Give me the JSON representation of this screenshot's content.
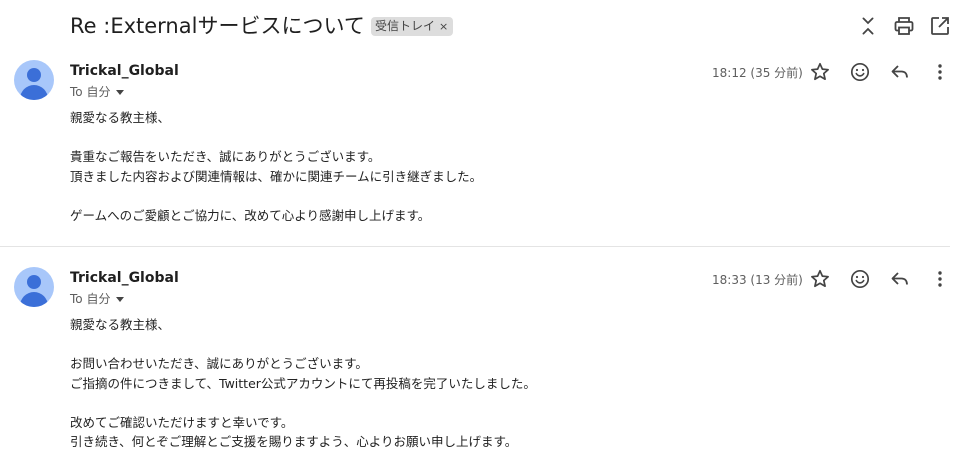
{
  "thread": {
    "subject": "Re :Externalサービスについて",
    "label": "受信トレイ",
    "label_remove": "×"
  },
  "icons": {
    "collapse": "unfold-less-icon",
    "print": "print-icon",
    "new_window": "open-in-new-icon",
    "star": "star-icon",
    "emoji": "emoji-icon",
    "reply": "reply-icon",
    "more": "more-vert-icon"
  },
  "messages": [
    {
      "sender": "Trickal_Global",
      "recipient": "To 自分",
      "time": "18:12 (35 分前)",
      "body": [
        "親愛なる教主様、",
        "",
        "貴重なご報告をいただき、誠にありがとうございます。",
        "頂きました内容および関連情報は、確かに関連チームに引き継ぎました。",
        "",
        "ゲームへのご愛顧とご協力に、改めて心より感謝申し上げます。"
      ]
    },
    {
      "sender": "Trickal_Global",
      "recipient": "To 自分",
      "time": "18:33 (13 分前)",
      "body": [
        "親愛なる教主様、",
        "",
        "お問い合わせいただき、誠にありがとうございます。",
        "ご指摘の件につきまして、Twitter公式アカウントにて再投稿を完了いたしました。",
        "",
        "改めてご確認いただけますと幸いです。",
        "引き続き、何とぞご理解とご支援を賜りますよう、心よりお願い申し上げます。"
      ]
    }
  ]
}
